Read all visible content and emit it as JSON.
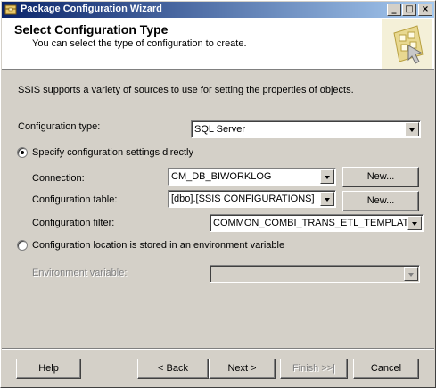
{
  "window": {
    "title": "Package Configuration Wizard"
  },
  "title_buttons": {
    "minimize": "_",
    "maximize": "□",
    "close": "×"
  },
  "header": {
    "title": "Select Configuration Type",
    "subtitle": "You can select the type of configuration to create."
  },
  "intro": "SSIS supports a variety of sources to use for setting the properties of objects.",
  "configuration_type": {
    "label": "Configuration type:",
    "value": "SQL Server"
  },
  "direct_option": {
    "label": "Specify configuration settings directly",
    "selected": true,
    "connection": {
      "label": "Connection:",
      "value": "CM_DB_BIWORKLOG",
      "button": "New..."
    },
    "table": {
      "label": "Configuration table:",
      "value": "[dbo].[SSIS CONFIGURATIONS]",
      "button": "New..."
    },
    "filter": {
      "label": "Configuration filter:",
      "value": "COMMON_COMBI_TRANS_ETL_TEMPLATE"
    }
  },
  "env_option": {
    "label": "Configuration location is stored in an environment variable",
    "selected": false,
    "variable": {
      "label": "Environment variable:",
      "value": ""
    }
  },
  "footer": {
    "help": "Help",
    "back": "< Back",
    "next": "Next >",
    "finish": "Finish >>|",
    "cancel": "Cancel"
  }
}
